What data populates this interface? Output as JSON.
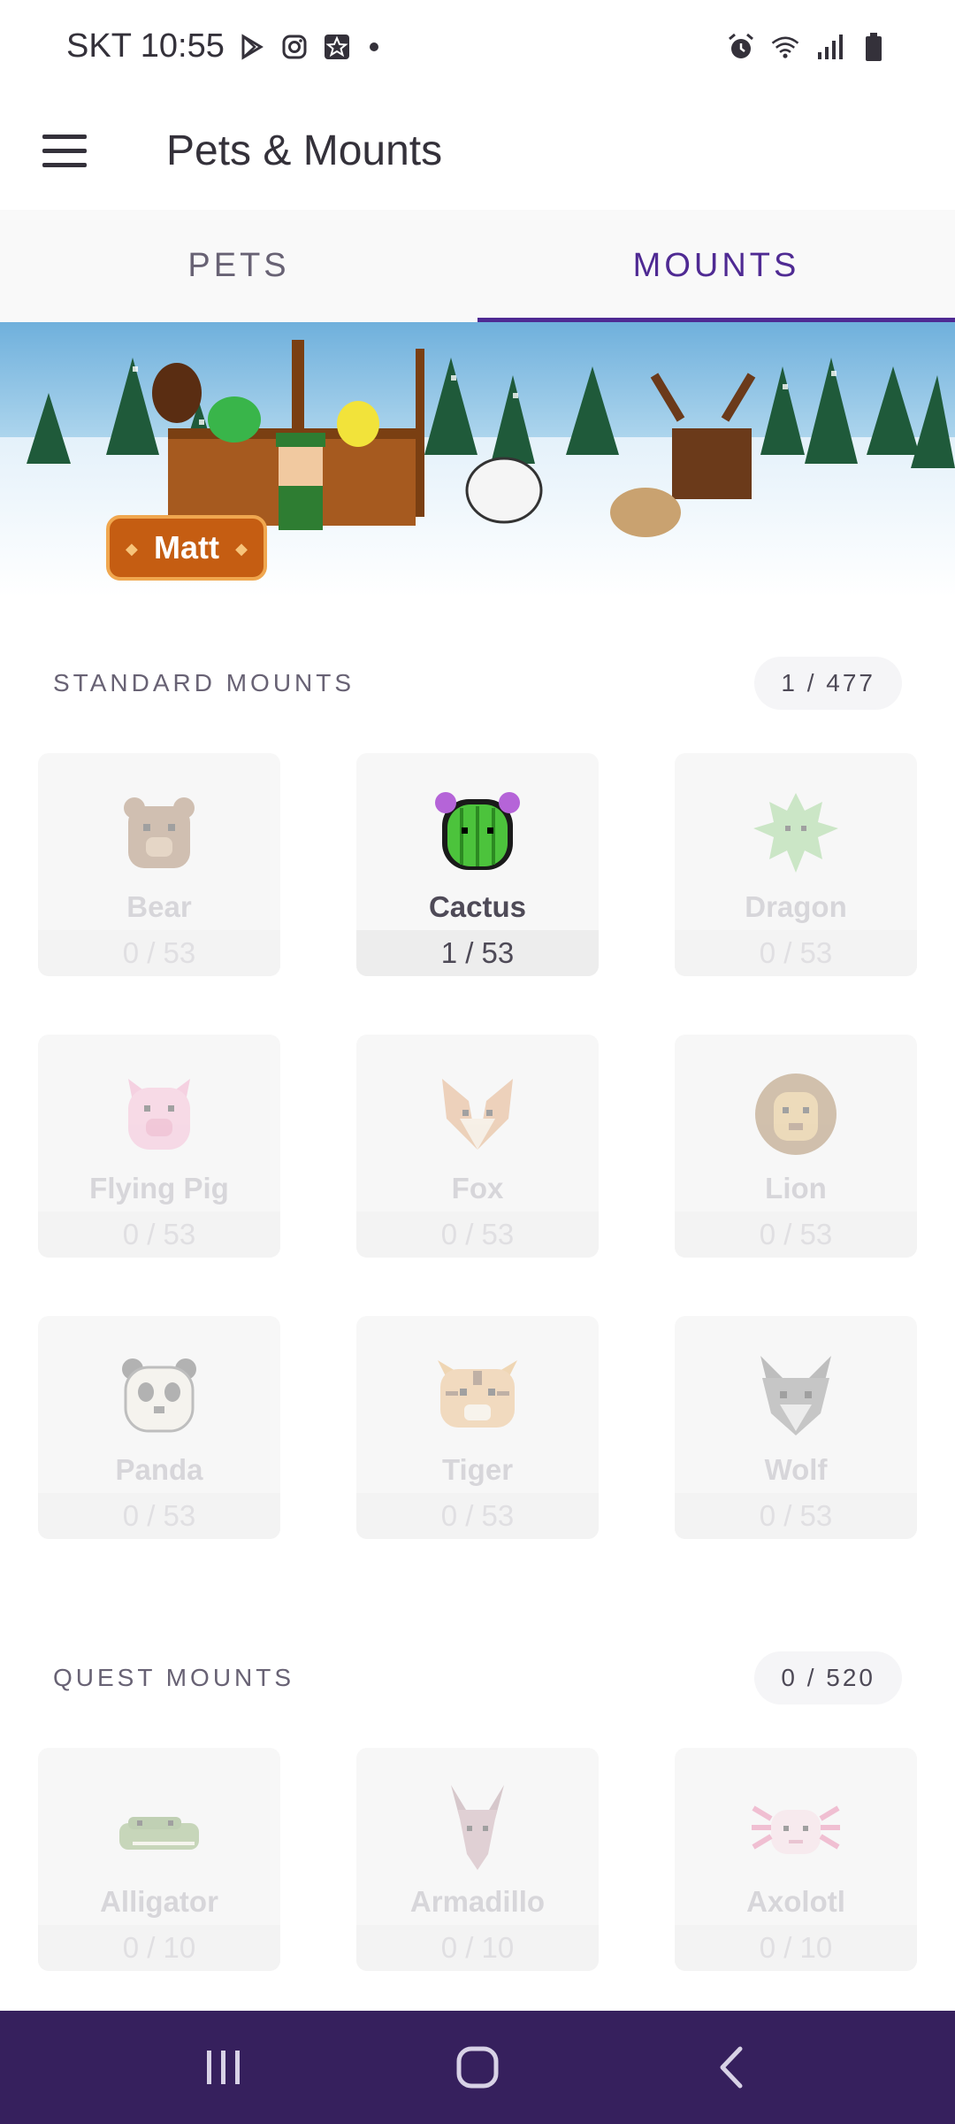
{
  "status_bar": {
    "carrier_time": "SKT 10:55",
    "left_icons": [
      "play-store-icon",
      "instagram-icon",
      "star-app-icon",
      "notification-dot"
    ],
    "right_icons": [
      "alarm-icon",
      "wifi-icon",
      "signal-icon",
      "battery-icon"
    ]
  },
  "app_bar": {
    "title": "Pets & Mounts"
  },
  "tabs": [
    {
      "label": "PETS",
      "active": false
    },
    {
      "label": "MOUNTS",
      "active": true
    }
  ],
  "banner": {
    "user_name": "Matt"
  },
  "standard_section": {
    "title": "STANDARD MOUNTS",
    "count": "1 / 477",
    "items": [
      {
        "name": "Bear",
        "count": "0 / 53"
      },
      {
        "name": "Cactus",
        "count": "1 / 53"
      },
      {
        "name": "Dragon",
        "count": "0 / 53"
      },
      {
        "name": "Flying Pig",
        "count": "0 / 53"
      },
      {
        "name": "Fox",
        "count": "0 / 53"
      },
      {
        "name": "Lion",
        "count": "0 / 53"
      },
      {
        "name": "Panda",
        "count": "0 / 53"
      },
      {
        "name": "Tiger",
        "count": "0 / 53"
      },
      {
        "name": "Wolf",
        "count": "0 / 53"
      }
    ]
  },
  "quest_section": {
    "title": "QUEST MOUNTS",
    "count": "0 / 520",
    "items": [
      {
        "name": "Alligator",
        "count": "0 / 10"
      },
      {
        "name": "Armadillo",
        "count": "0 / 10"
      },
      {
        "name": "Axolotl",
        "count": "0 / 10"
      }
    ]
  },
  "colors": {
    "accent": "#4f2a93",
    "nav_bar": "#36205d",
    "badge": "#c55d12"
  },
  "nav_bar": {
    "buttons": [
      "recents-icon",
      "home-icon",
      "back-icon"
    ]
  }
}
